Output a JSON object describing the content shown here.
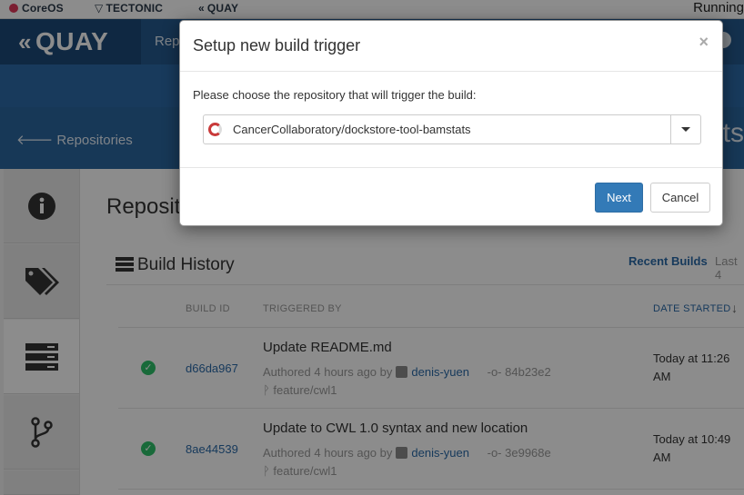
{
  "topbar": {
    "brands": [
      "CoreOS",
      "TECTONIC",
      "QUAY"
    ],
    "running_text": "Running"
  },
  "nav": {
    "logo_text": "QUAY",
    "link_label": "Rep"
  },
  "header": {
    "back_label": "Repositories",
    "right_text": "nts"
  },
  "main": {
    "title": "Reposito",
    "build_history": {
      "title": "Build History",
      "recent_label": "Recent Builds",
      "last_label": "Last 4",
      "columns": {
        "build_id": "BUILD ID",
        "triggered_by": "TRIGGERED BY",
        "date_started": "DATE STARTED"
      },
      "rows": [
        {
          "build_id": "d66da967",
          "message": "Update README.md",
          "authored": "Authored 4 hours ago by",
          "user": "denis-yuen",
          "commit": "84b23e2",
          "branch": "feature/cwl1",
          "date_line1": "Today at 11:26",
          "date_line2": "AM",
          "status": "success"
        },
        {
          "build_id": "8ae44539",
          "message": "Update to CWL 1.0 syntax and new location",
          "authored": "Authored 4 hours ago by",
          "user": "denis-yuen",
          "commit": "3e9968e",
          "branch": "feature/cwl1",
          "date_line1": "Today at 10:49",
          "date_line2": "AM",
          "status": "success"
        }
      ]
    }
  },
  "modal": {
    "title": "Setup new build trigger",
    "close_glyph": "×",
    "prompt": "Please choose the repository that will trigger the build:",
    "selected_repository": "CancerCollaboratory/dockstore-tool-bamstats",
    "next_label": "Next",
    "cancel_label": "Cancel"
  },
  "colors": {
    "primary": "#337ab7",
    "nav": "#255a8f",
    "success": "#2fc26b",
    "link": "#2b6aa8"
  }
}
